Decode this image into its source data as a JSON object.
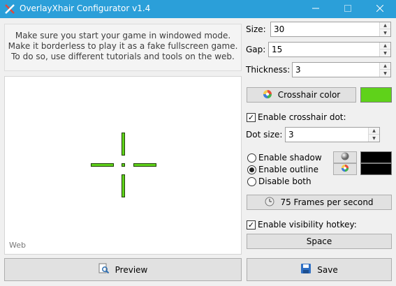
{
  "window": {
    "title": "OverlayXhair Configurator v1.4"
  },
  "colors": {
    "titlebar": "#2b9fd9",
    "crosshair": "#5fd21a",
    "shadow": "#000000",
    "outline": "#000000"
  },
  "info": {
    "lines": [
      "Make sure you start your game in windowed mode.",
      "Make it borderless to play it as a fake fullscreen game.",
      "To do so, use different tutorials and tools on the web."
    ]
  },
  "preview": {
    "watermark": "Web"
  },
  "settings": {
    "size_label": "Size:",
    "size_value": "30",
    "gap_label": "Gap:",
    "gap_value": "15",
    "thickness_label": "Thickness:",
    "thickness_value": "3",
    "crosshair_color_label": "Crosshair color",
    "dot_enabled": true,
    "dot_label": "Enable crosshair dot:",
    "dot_size_label": "Dot size:",
    "dot_size_value": "3",
    "shadow_label": "Enable shadow",
    "outline_label": "Enable outline",
    "disable_label": "Disable both",
    "selected_mode": "outline",
    "fps_label": "75 Frames per second",
    "hotkey_enabled": true,
    "hotkey_label": "Enable visibility hotkey:",
    "hotkey_value": "Space"
  },
  "buttons": {
    "preview": "Preview",
    "save": "Save"
  }
}
